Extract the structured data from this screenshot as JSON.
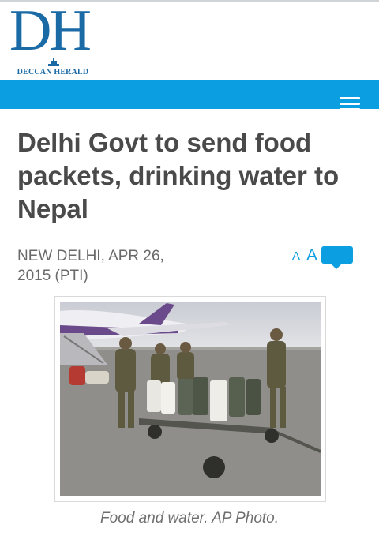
{
  "header": {
    "logo_text": "DH",
    "logo_tagline": "DECCAN HERALD",
    "menu_icon": "hamburger-menu-icon",
    "accent_color": "#0b9ee0",
    "logo_color": "#1a6aa6"
  },
  "article": {
    "headline": "Delhi Govt to send food packets, drinking water to Nepal",
    "dateline": "NEW DELHI, APR 26, 2015 (PTI)",
    "font_size_small_label": "A",
    "font_size_large_label": "A",
    "comment_icon": "comment-bubble-icon",
    "photo_caption": "Food and water. AP Photo."
  }
}
